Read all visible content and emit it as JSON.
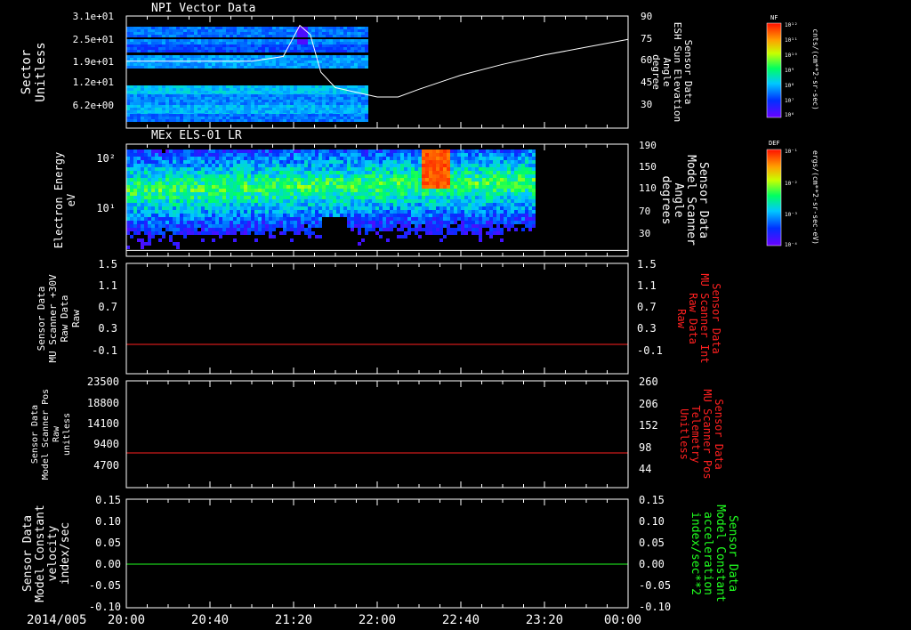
{
  "date_label": "2014/005",
  "colors": {
    "background": "#000000",
    "axis": "#ffffff",
    "red": "#ff2020",
    "green": "#20ff20",
    "white": "#ffffff"
  },
  "x_axis": {
    "start": "20:00",
    "end": "00:00",
    "tick_labels": [
      "20:00",
      "20:40",
      "21:20",
      "22:00",
      "22:40",
      "23:20",
      "00:00"
    ]
  },
  "panels": [
    {
      "id": "npi",
      "title": "NPI Vector Data",
      "left_label": [
        "Sector",
        "Unitless"
      ],
      "left_ticks": [
        "3.1e+01",
        "2.5e+01",
        "1.9e+01",
        "1.2e+01",
        "6.2e+00"
      ],
      "right_label": [
        "Sensor Data",
        "ESH Sun Elevation",
        "Angle",
        "degree"
      ],
      "right_ticks": [
        "90",
        "75",
        "60",
        "45",
        "30"
      ],
      "colorbar": {
        "name": "NF",
        "unit": "cnts/(cm**2-sr-sec)",
        "tick_labels": [
          "10¹²",
          "10¹¹",
          "10¹⁰",
          "10⁹",
          "10⁸",
          "10⁷",
          "10⁶"
        ]
      }
    },
    {
      "id": "els",
      "title": "MEx ELS-01 LR",
      "left_label": [
        "Electron Energy",
        "eV"
      ],
      "left_ticks": [
        "10²",
        "10¹"
      ],
      "right_label": [
        "Sensor Data",
        "Model Scanner",
        "Angle",
        "degrees"
      ],
      "right_ticks": [
        "190",
        "150",
        "110",
        "70",
        "30"
      ],
      "colorbar": {
        "name": "DEF",
        "unit": "ergs/(cm**2-sr-sec-eV)",
        "tick_labels": [
          "10⁻¹",
          "10⁻²",
          "10⁻³",
          "10⁻⁴"
        ]
      }
    },
    {
      "id": "raw",
      "left_label": [
        "Sensor Data",
        "MU Scanner +30V",
        "Raw Data",
        "Raw"
      ],
      "left_ticks": [
        "1.5",
        "1.1",
        "0.7",
        "0.3",
        "-0.1"
      ],
      "right_label": [
        "Sensor Data",
        "MU Scanner Int",
        "Raw Data",
        "Raw"
      ],
      "right_ticks": [
        "1.5",
        "1.1",
        "0.7",
        "0.3",
        "-0.1"
      ]
    },
    {
      "id": "pos",
      "left_label": [
        "Sensor Data",
        "Model Scanner Pos",
        "Raw",
        "unitless"
      ],
      "left_ticks": [
        "23500",
        "18800",
        "14100",
        "9400",
        "4700"
      ],
      "right_label": [
        "Sensor Data",
        "MU Scanner Pos",
        "Telemetry",
        "Unitless"
      ],
      "right_ticks": [
        "260",
        "206",
        "152",
        "98",
        "44"
      ]
    },
    {
      "id": "vel",
      "left_label": [
        "Sensor Data",
        "Model Constant",
        "velocity",
        "index/sec"
      ],
      "left_ticks": [
        "0.15",
        "0.10",
        "0.05",
        "0.00",
        "-0.05",
        "-0.10"
      ],
      "right_label": [
        "Sensor Data",
        "Model Constant",
        "acceleration",
        "index/sec**2"
      ],
      "right_ticks": [
        "0.15",
        "0.10",
        "0.05",
        "0.00",
        "-0.05",
        "-0.10"
      ]
    }
  ],
  "chart_data": [
    {
      "type": "heatmap",
      "title": "NPI Vector Data",
      "ylabel": "Sector Unitless",
      "x_range": [
        "20:00",
        "00:00"
      ],
      "y_ticks": [
        "3.1e+01",
        "2.5e+01",
        "1.9e+01",
        "1.2e+01",
        "6.2e+00"
      ],
      "data_end_time": "21:55",
      "overlay_series": {
        "name": "Sensor Data ESH Sun Elevation Angle",
        "y_unit": "degree",
        "ylim": [
          18,
          90
        ],
        "x": [
          "20:00",
          "21:00",
          "21:15",
          "21:23",
          "21:28",
          "21:33",
          "21:40",
          "21:50",
          "22:00",
          "22:10",
          "22:20",
          "22:40",
          "23:00",
          "23:20",
          "23:40",
          "00:00"
        ],
        "values": [
          61,
          61,
          64,
          84,
          78,
          54,
          44,
          41,
          38,
          38,
          43,
          52,
          59,
          65,
          70,
          75
        ]
      }
    },
    {
      "type": "heatmap",
      "title": "MEx ELS-01 LR",
      "ylabel": "Electron Energy eV",
      "y_scale": "log",
      "x_range": [
        "20:00",
        "00:00"
      ],
      "data_end_time": "23:15",
      "overlay_series": {
        "name": "Sensor Data Model Scanner Angle",
        "y_unit": "degrees",
        "ylim": [
          0,
          190
        ],
        "x": [
          "20:00",
          "00:00"
        ],
        "values": [
          10,
          10
        ]
      }
    },
    {
      "type": "line",
      "series": [
        {
          "name": "Sensor Data MU Scanner +30V Raw Data",
          "x": [
            "20:00",
            "00:00"
          ],
          "values": [
            0.0,
            0.0
          ],
          "ylim": [
            -0.3,
            1.5
          ]
        },
        {
          "name": "Sensor Data MU Scanner Int Raw Data",
          "x": [
            "20:00",
            "00:00"
          ],
          "values": [
            0.0,
            0.0
          ],
          "ylim": [
            -0.3,
            1.5
          ]
        }
      ]
    },
    {
      "type": "line",
      "series": [
        {
          "name": "Sensor Data Model Scanner Pos Raw",
          "x": [
            "20:00",
            "00:00"
          ],
          "values": [
            8300,
            8300
          ],
          "ylim": [
            0,
            23500
          ]
        },
        {
          "name": "Sensor Data MU Scanner Pos Telemetry",
          "x": [
            "20:00",
            "00:00"
          ],
          "values": [
            88,
            88
          ],
          "ylim": [
            0,
            260
          ]
        }
      ]
    },
    {
      "type": "line",
      "series": [
        {
          "name": "Sensor Data Model Constant velocity",
          "x": [
            "20:00",
            "00:00"
          ],
          "values": [
            0.0,
            0.0
          ],
          "ylim": [
            -0.1,
            0.15
          ]
        },
        {
          "name": "Sensor Data Model Constant acceleration",
          "x": [
            "20:00",
            "00:00"
          ],
          "values": [
            0.0,
            0.0
          ],
          "ylim": [
            -0.1,
            0.15
          ]
        }
      ]
    }
  ]
}
